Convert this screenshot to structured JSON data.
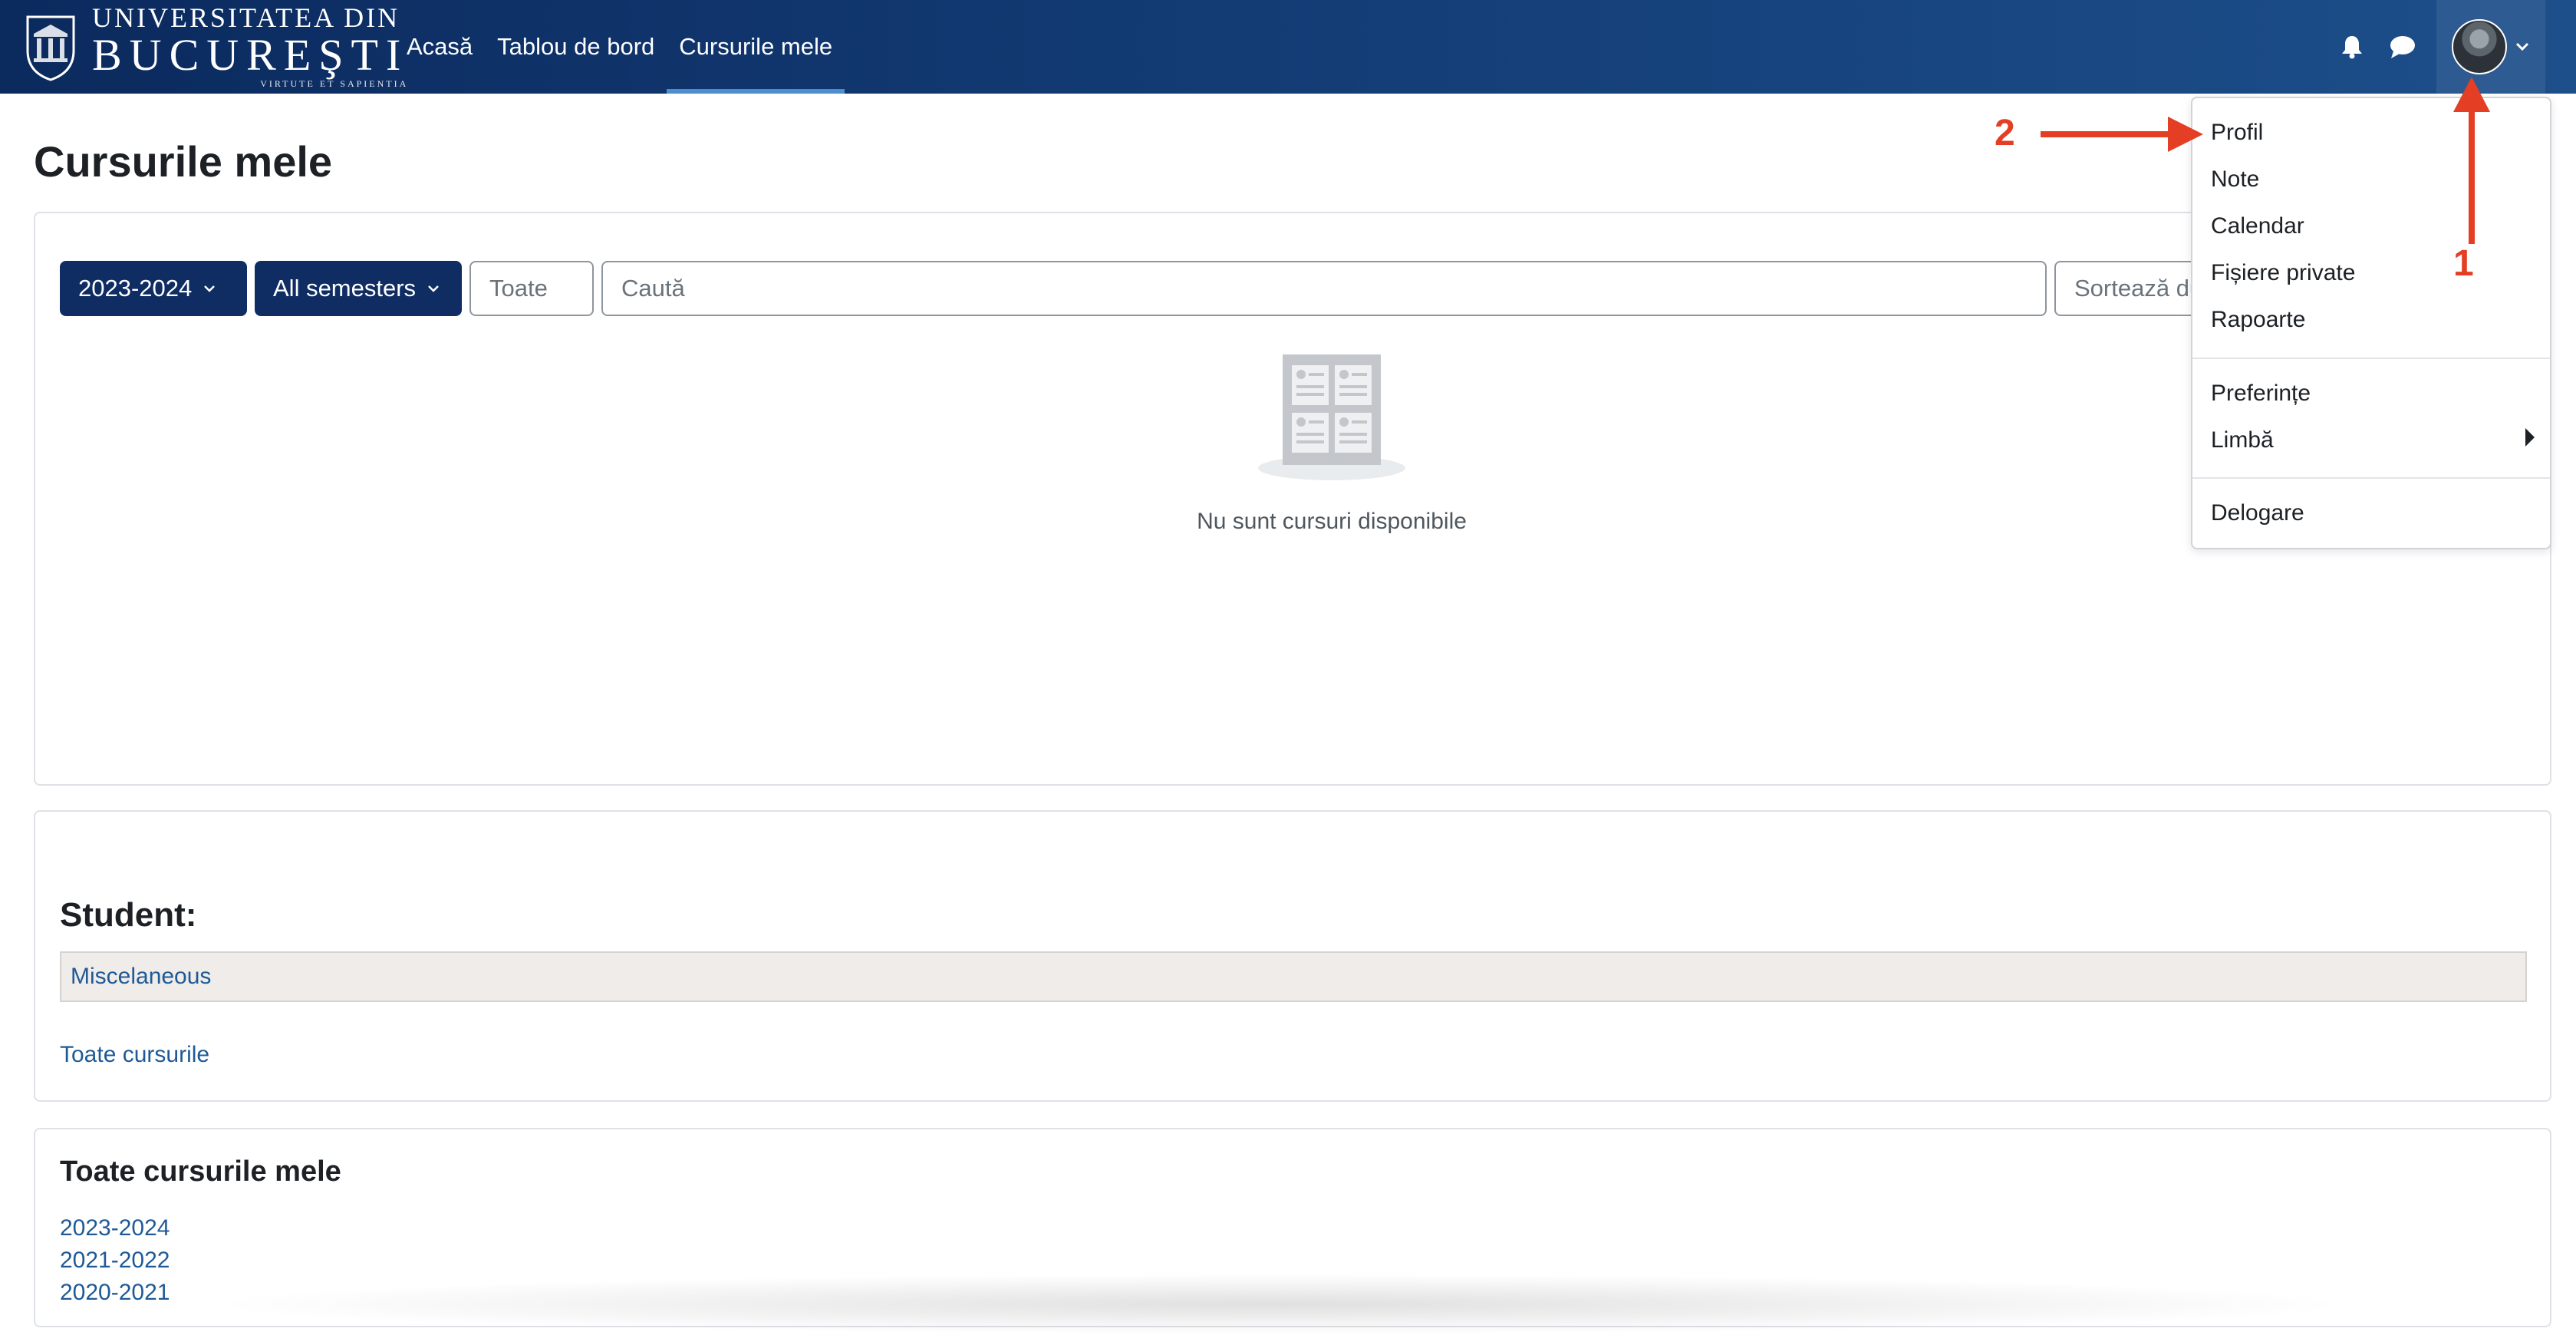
{
  "brand": {
    "line1": "Universitatea din",
    "line2": "Bucureşti",
    "line3": "VIRTUTE ET SAPIENTIA"
  },
  "nav": {
    "links": [
      {
        "label": "Acasă"
      },
      {
        "label": "Tablou de bord"
      },
      {
        "label": "Cursurile mele"
      }
    ]
  },
  "page": {
    "title": "Cursurile mele"
  },
  "filters": {
    "year": "2023-2024",
    "semester": "All semesters",
    "status": "Toate",
    "search_placeholder": "Caută",
    "sort": "Sortează du"
  },
  "empty_state": {
    "text": "Nu sunt cursuri disponibile"
  },
  "student_card": {
    "heading": "Student:",
    "category": "Miscelaneous",
    "all_courses_link": "Toate cursurile"
  },
  "all_my_courses": {
    "heading": "Toate cursurile mele",
    "years": [
      "2023-2024",
      "2021-2022",
      "2020-2021"
    ]
  },
  "user_menu": {
    "items": [
      {
        "label": "Profil"
      },
      {
        "label": "Note"
      },
      {
        "label": "Calendar"
      },
      {
        "label": "Fișiere private"
      },
      {
        "label": "Rapoarte"
      },
      {
        "label": "Preferințe"
      },
      {
        "label": "Limbă"
      },
      {
        "label": "Delogare"
      }
    ]
  },
  "annotations": {
    "one": "1",
    "two": "2",
    "color": "#e43e24"
  },
  "colors": {
    "navbar": "#0b2a5e",
    "primary_button": "#0f2c63",
    "link": "#1f5a96"
  }
}
